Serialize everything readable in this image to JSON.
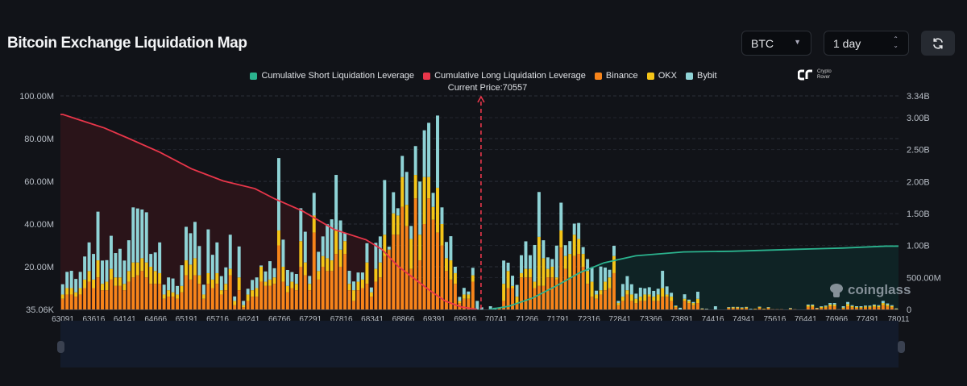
{
  "header": {
    "title": "Bitcoin Exchange Liquidation Map",
    "coin_select": "BTC",
    "range_select": "1 day",
    "refresh_icon": "refresh-icon"
  },
  "legend": [
    "Cumulative Short Liquidation Leverage",
    "Cumulative Long Liquidation Leverage",
    "Binance",
    "OKX",
    "Bybit"
  ],
  "current_price_label": "Current Price:70557",
  "logo": {
    "line1": "Crypto",
    "line2": "Rover"
  },
  "watermark": "coinglass",
  "colors": {
    "short": "#2bb38e",
    "long": "#e8364a",
    "binance": "#f7841a",
    "okx": "#f5c518",
    "bybit": "#8fd3d6",
    "background": "#111318"
  },
  "chart_data": {
    "type": "bar",
    "current_price": 70557,
    "x_ticks": [
      "63091",
      "63616",
      "64141",
      "64666",
      "65191",
      "65716",
      "66241",
      "66766",
      "67291",
      "67816",
      "68341",
      "68866",
      "69391",
      "69916",
      "70741",
      "71266",
      "71791",
      "72316",
      "72841",
      "73366",
      "73891",
      "74416",
      "74941",
      "75616",
      "76441",
      "76966",
      "77491",
      "78011"
    ],
    "x_range": [
      63091,
      78011
    ],
    "y_left": {
      "ticks": [
        "100.00M",
        "80.00M",
        "60.00M",
        "40.00M",
        "20.00M",
        "35.06K"
      ],
      "range_millions": [
        0,
        100
      ]
    },
    "y_right": {
      "ticks": [
        "3.34B",
        "3.00B",
        "2.50B",
        "2.00B",
        "1.50B",
        "1.00B",
        "500.00M",
        "0"
      ],
      "range_billions": [
        0,
        3.34
      ]
    },
    "grid": true,
    "legend_position": "top",
    "bar_series_order": [
      "Binance",
      "OKX",
      "Bybit"
    ],
    "bars_millions": [
      [
        5,
        2,
        4.8
      ],
      [
        7,
        3,
        7.6
      ],
      [
        7,
        3,
        8.1
      ],
      [
        6,
        2,
        6.3
      ],
      [
        7,
        3,
        7.6
      ],
      [
        10,
        4,
        10.8
      ],
      [
        13,
        5,
        13.4
      ],
      [
        10,
        4,
        12
      ],
      [
        15,
        8,
        22.8
      ],
      [
        9,
        3,
        10.9
      ],
      [
        9,
        4,
        10.1
      ],
      [
        14,
        5,
        15.5
      ],
      [
        11,
        4,
        11.4
      ],
      [
        11,
        4,
        13.4
      ],
      [
        9,
        3,
        10.9
      ],
      [
        13,
        5,
        14.4
      ],
      [
        15,
        7,
        25.8
      ],
      [
        16,
        6,
        25.3
      ],
      [
        18,
        6,
        22.8
      ],
      [
        15,
        7,
        23.5
      ],
      [
        12,
        8,
        6
      ],
      [
        12,
        6,
        8.7
      ],
      [
        12,
        5,
        14.4
      ],
      [
        5,
        2,
        4.6
      ],
      [
        6,
        3,
        6
      ],
      [
        6,
        2,
        6.5
      ],
      [
        5,
        2,
        4
      ],
      [
        8,
        3,
        9.7
      ],
      [
        16,
        7,
        15.7
      ],
      [
        14,
        7,
        14.7
      ],
      [
        16,
        8,
        17
      ],
      [
        12,
        4,
        13.7
      ],
      [
        5,
        2,
        4.6
      ],
      [
        12,
        5,
        20.5
      ],
      [
        10,
        4,
        11.6
      ],
      [
        12,
        5,
        14.4
      ],
      [
        7,
        2,
        6.6
      ],
      [
        9,
        3,
        7.7
      ],
      [
        16,
        3,
        16
      ],
      [
        2,
        2,
        2.1
      ],
      [
        9,
        6,
        14.5
      ],
      [
        1,
        1,
        2
      ],
      [
        4,
        3,
        2.7
      ],
      [
        6,
        3,
        4.8
      ],
      [
        6,
        4,
        5
      ],
      [
        13,
        7,
        0.6
      ],
      [
        11,
        2,
        4.8
      ],
      [
        11,
        3,
        8.6
      ],
      [
        12,
        3,
        4.3
      ],
      [
        30,
        7,
        33.9
      ],
      [
        13,
        7,
        12.7
      ],
      [
        8,
        3,
        7.5
      ],
      [
        10,
        3,
        4.5
      ],
      [
        9,
        3,
        4.6
      ],
      [
        20,
        12,
        15.4
      ],
      [
        16,
        6,
        14.4
      ],
      [
        9,
        3,
        3.7
      ],
      [
        36,
        8,
        10.6
      ],
      [
        14,
        4,
        9
      ],
      [
        20,
        5,
        9.2
      ],
      [
        18,
        6,
        15.9
      ],
      [
        18,
        5,
        19.2
      ],
      [
        26,
        11,
        26
      ],
      [
        20,
        8,
        13.7
      ],
      [
        26,
        6,
        3.9
      ],
      [
        9,
        3,
        6.1
      ],
      [
        4,
        5,
        4.1
      ],
      [
        9,
        4,
        4.3
      ],
      [
        10,
        4,
        3.3
      ],
      [
        12,
        10,
        9
      ],
      [
        6,
        2,
        2.3
      ],
      [
        13,
        6,
        12.2
      ],
      [
        15,
        7,
        12.2
      ],
      [
        25,
        10,
        25.6
      ],
      [
        28,
        0,
        1.4
      ],
      [
        35,
        10,
        9.9
      ],
      [
        35,
        9,
        3.4
      ],
      [
        48,
        14,
        9.9
      ],
      [
        39,
        10,
        15.4
      ],
      [
        19,
        14,
        6.1
      ],
      [
        52,
        11,
        13.5
      ],
      [
        23,
        12,
        24.9
      ],
      [
        40,
        22,
        21.9
      ],
      [
        52,
        10,
        25.4
      ],
      [
        42,
        6,
        6.6
      ],
      [
        36,
        21,
        33.8
      ],
      [
        30,
        10,
        7.8
      ],
      [
        18,
        6,
        7.6
      ],
      [
        14,
        9,
        11.3
      ],
      [
        12,
        5,
        3
      ],
      [
        3,
        1,
        1.9
      ],
      [
        5,
        2,
        3.1
      ],
      [
        5,
        2,
        1.4
      ],
      [
        13,
        3,
        3.5
      ],
      [
        0,
        0,
        4
      ],
      [
        0,
        0,
        1
      ],
      [
        0,
        0,
        0
      ],
      [
        0,
        0,
        1.5
      ],
      [
        0,
        0,
        0.8
      ],
      [
        0.3,
        0.3,
        0.2
      ],
      [
        4,
        8,
        10.9
      ],
      [
        10,
        8,
        3.9
      ],
      [
        10,
        1,
        4.8
      ],
      [
        3,
        3,
        5.5
      ],
      [
        15,
        2,
        8.4
      ],
      [
        15,
        4,
        12.9
      ],
      [
        15,
        4,
        6.4
      ],
      [
        10,
        3,
        17.2
      ],
      [
        11,
        23,
        21
      ],
      [
        11,
        13,
        8.4
      ],
      [
        15,
        4,
        5.4
      ],
      [
        15,
        5,
        3.6
      ],
      [
        14,
        1,
        14.9
      ],
      [
        29,
        8,
        13
      ],
      [
        19,
        6,
        5.1
      ],
      [
        15,
        11,
        6
      ],
      [
        25,
        10,
        5.2
      ],
      [
        26,
        7,
        7.5
      ],
      [
        20,
        6,
        3.2
      ],
      [
        12,
        6,
        5.6
      ],
      [
        6,
        7,
        6.4
      ],
      [
        5,
        2,
        1.8
      ],
      [
        7,
        2,
        11.1
      ],
      [
        9,
        4,
        6.6
      ],
      [
        10,
        5,
        3.6
      ],
      [
        17,
        8,
        4.8
      ],
      [
        2,
        1,
        1
      ],
      [
        4,
        2,
        5.9
      ],
      [
        7,
        2,
        6.6
      ],
      [
        4,
        3,
        4.8
      ],
      [
        3,
        2,
        2.4
      ],
      [
        4,
        2,
        4.2
      ],
      [
        4,
        3,
        2.9
      ],
      [
        6,
        1,
        3.4
      ],
      [
        4,
        2,
        2.7
      ],
      [
        4,
        3,
        2.7
      ],
      [
        6,
        4,
        8.1
      ],
      [
        6,
        1,
        3.8
      ],
      [
        4,
        2,
        1.8
      ],
      [
        1,
        0.5,
        0.3
      ],
      [
        0,
        0,
        0.8
      ],
      [
        4,
        1,
        2.1
      ],
      [
        3,
        1,
        0.6
      ],
      [
        2,
        1,
        0.5
      ],
      [
        3,
        2,
        3.3
      ],
      [
        0.3,
        0.1,
        0.1
      ],
      [
        0.2,
        0,
        0.1
      ],
      [
        0,
        0,
        0
      ],
      [
        0,
        0,
        1.5
      ],
      [
        0,
        0,
        0
      ],
      [
        0,
        0,
        0
      ],
      [
        0.6,
        0.3,
        0.2
      ],
      [
        0.6,
        0.4,
        0.2
      ],
      [
        0.6,
        0.4,
        0.2
      ],
      [
        0.5,
        0.3,
        0.2
      ],
      [
        0.6,
        0.4,
        0.2
      ],
      [
        0,
        0,
        0.3
      ],
      [
        0.2,
        0.1,
        0
      ],
      [
        0.7,
        0.4,
        0.2
      ],
      [
        0.2,
        0.1,
        0
      ],
      [
        0.6,
        0.3,
        0.2
      ],
      [
        0.1,
        0,
        0
      ],
      [
        0.1,
        0,
        0
      ],
      [
        0.1,
        0,
        0
      ],
      [
        0,
        0,
        0
      ],
      [
        0.3,
        0.2,
        0.2
      ],
      [
        0.1,
        0,
        0
      ],
      [
        0,
        0,
        0
      ],
      [
        0,
        0,
        0
      ],
      [
        1.2,
        0.7,
        0.4
      ],
      [
        1.2,
        0.7,
        0.4
      ],
      [
        0.4,
        0.2,
        0.1
      ],
      [
        0.7,
        0.5,
        0.3
      ],
      [
        0.9,
        0.5,
        0.4
      ],
      [
        1.5,
        0.8,
        0.7
      ],
      [
        1.5,
        0.8,
        0.7
      ],
      [
        0.1,
        0,
        0
      ],
      [
        0.5,
        0.4,
        0.6
      ],
      [
        1.5,
        1,
        1
      ],
      [
        1,
        0.6,
        0.4
      ],
      [
        0.7,
        0.4,
        0.4
      ],
      [
        0.7,
        0.4,
        0.4
      ],
      [
        0.9,
        0.5,
        0.4
      ],
      [
        0.9,
        0.5,
        0.4
      ],
      [
        1.2,
        0.7,
        0.4
      ],
      [
        1,
        0.6,
        0.4
      ],
      [
        2,
        1,
        1
      ],
      [
        1.4,
        0.8,
        0.6
      ],
      [
        1,
        0.6,
        0.4
      ],
      [
        0.2,
        0.1,
        0.2
      ]
    ],
    "cumulative_long_billions": [
      [
        63091,
        3.05
      ],
      [
        63403,
        2.96
      ],
      [
        63828,
        2.84
      ],
      [
        64253,
        2.68
      ],
      [
        64820,
        2.46
      ],
      [
        65387,
        2.2
      ],
      [
        65953,
        2.01
      ],
      [
        66520,
        1.89
      ],
      [
        66874,
        1.73
      ],
      [
        67370,
        1.54
      ],
      [
        67937,
        1.25
      ],
      [
        68504,
        1.09
      ],
      [
        68787,
        0.94
      ],
      [
        69071,
        0.68
      ],
      [
        69354,
        0.49
      ],
      [
        69638,
        0.3
      ],
      [
        69921,
        0.13
      ],
      [
        70204,
        0.04
      ],
      [
        70488,
        0
      ]
    ],
    "cumulative_short_billions": [
      [
        70700,
        0
      ],
      [
        71055,
        0.05
      ],
      [
        71480,
        0.18
      ],
      [
        71905,
        0.37
      ],
      [
        72330,
        0.58
      ],
      [
        72755,
        0.73
      ],
      [
        73322,
        0.84
      ],
      [
        74172,
        0.9
      ],
      [
        75022,
        0.91
      ],
      [
        76156,
        0.94
      ],
      [
        77006,
        0.96
      ],
      [
        77786,
        0.99
      ]
    ]
  }
}
